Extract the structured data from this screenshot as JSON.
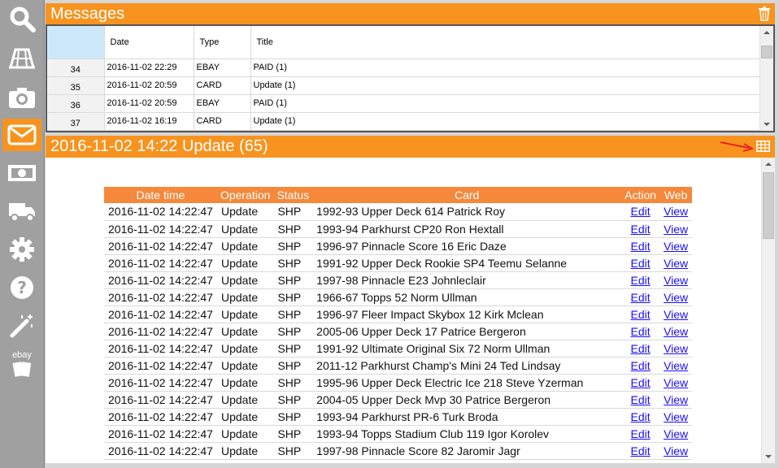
{
  "sidebar": {
    "items": [
      {
        "icon": "search-icon"
      },
      {
        "icon": "store-icon"
      },
      {
        "icon": "camera-icon"
      },
      {
        "icon": "mail-icon",
        "active": true
      },
      {
        "icon": "cash-icon"
      },
      {
        "icon": "truck-icon"
      },
      {
        "icon": "gear-icon"
      },
      {
        "icon": "help-icon"
      },
      {
        "icon": "magic-wand-icon"
      },
      {
        "icon": "ebay-icon",
        "label": "ebay"
      }
    ]
  },
  "messages": {
    "title": "Messages",
    "columns": {
      "date": "Date",
      "type": "Type",
      "title": "Title"
    },
    "rows": [
      {
        "num": "34",
        "date": "2016-11-02 22:29",
        "type": "EBAY",
        "title": "PAID (1)"
      },
      {
        "num": "35",
        "date": "2016-11-02 20:59",
        "type": "CARD",
        "title": "Update (1)"
      },
      {
        "num": "36",
        "date": "2016-11-02 20:59",
        "type": "EBAY",
        "title": "PAID (1)"
      },
      {
        "num": "37",
        "date": "2016-11-02 16:19",
        "type": "CARD",
        "title": "Update (1)"
      }
    ]
  },
  "detail": {
    "title": "2016-11-02 14:22 Update (65)",
    "columns": {
      "datetime": "Date time",
      "operation": "Operation",
      "status": "Status",
      "card": "Card",
      "action": "Action",
      "web": "Web"
    },
    "rows": [
      {
        "datetime": "2016-11-02 14:22:47",
        "operation": "Update",
        "status": "SHP",
        "card": "1992-93 Upper Deck 614 Patrick Roy",
        "action": "Edit",
        "web": "View"
      },
      {
        "datetime": "2016-11-02 14:22:47",
        "operation": "Update",
        "status": "SHP",
        "card": "1993-94 Parkhurst CP20 Ron Hextall",
        "action": "Edit",
        "web": "View"
      },
      {
        "datetime": "2016-11-02 14:22:47",
        "operation": "Update",
        "status": "SHP",
        "card": "1996-97 Pinnacle Score 16 Eric Daze",
        "action": "Edit",
        "web": "View"
      },
      {
        "datetime": "2016-11-02 14:22:47",
        "operation": "Update",
        "status": "SHP",
        "card": "1991-92 Upper Deck Rookie SP4 Teemu Selanne",
        "action": "Edit",
        "web": "View"
      },
      {
        "datetime": "2016-11-02 14:22:47",
        "operation": "Update",
        "status": "SHP",
        "card": "1997-98 Pinnacle E23 Johnleclair",
        "action": "Edit",
        "web": "View"
      },
      {
        "datetime": "2016-11-02 14:22:47",
        "operation": "Update",
        "status": "SHP",
        "card": "1966-67 Topps 52 Norm Ullman",
        "action": "Edit",
        "web": "View"
      },
      {
        "datetime": "2016-11-02 14:22:47",
        "operation": "Update",
        "status": "SHP",
        "card": "1996-97 Fleer Impact Skybox 12 Kirk Mclean",
        "action": "Edit",
        "web": "View"
      },
      {
        "datetime": "2016-11-02 14:22:47",
        "operation": "Update",
        "status": "SHP",
        "card": "2005-06 Upper Deck 17 Patrice Bergeron",
        "action": "Edit",
        "web": "View"
      },
      {
        "datetime": "2016-11-02 14:22:47",
        "operation": "Update",
        "status": "SHP",
        "card": "1991-92 Ultimate Original Six 72 Norm Ullman",
        "action": "Edit",
        "web": "View"
      },
      {
        "datetime": "2016-11-02 14:22:47",
        "operation": "Update",
        "status": "SHP",
        "card": "2011-12 Parkhurst Champ's Mini 24 Ted Lindsay",
        "action": "Edit",
        "web": "View"
      },
      {
        "datetime": "2016-11-02 14:22:47",
        "operation": "Update",
        "status": "SHP",
        "card": "1995-96 Upper Deck Electric Ice 218 Steve Yzerman",
        "action": "Edit",
        "web": "View"
      },
      {
        "datetime": "2016-11-02 14:22:47",
        "operation": "Update",
        "status": "SHP",
        "card": "2004-05 Upper Deck Mvp 30 Patrice Bergeron",
        "action": "Edit",
        "web": "View"
      },
      {
        "datetime": "2016-11-02 14:22:47",
        "operation": "Update",
        "status": "SHP",
        "card": "1993-94 Parkhurst PR-6 Turk Broda",
        "action": "Edit",
        "web": "View"
      },
      {
        "datetime": "2016-11-02 14:22:47",
        "operation": "Update",
        "status": "SHP",
        "card": "1993-94 Topps Stadium Club 119 Igor Korolev",
        "action": "Edit",
        "web": "View"
      },
      {
        "datetime": "2016-11-02 14:22:47",
        "operation": "Update",
        "status": "SHP",
        "card": "1997-98 Pinnacle Score 82 Jaromir Jagr",
        "action": "Edit",
        "web": "View"
      }
    ]
  },
  "colors": {
    "accent": "#f7931e",
    "sidebar": "#a0a0a0",
    "link": "#1a0dff"
  }
}
